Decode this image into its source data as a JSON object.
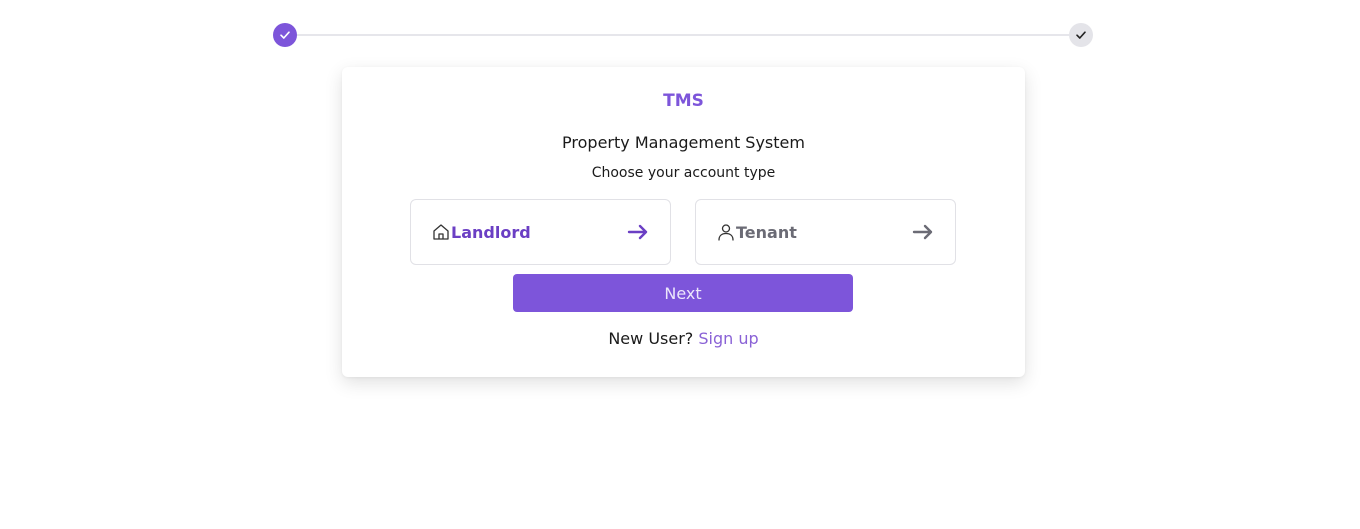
{
  "stepper": {
    "steps": [
      {
        "status": "complete",
        "icon": "check-icon",
        "color": "#7d55da"
      },
      {
        "status": "complete",
        "icon": "check-icon",
        "color": "#e4e4e9"
      }
    ]
  },
  "card": {
    "brand": "TMS",
    "subtitle": "Property Management System",
    "prompt": "Choose your account type",
    "options": [
      {
        "label": "Landlord",
        "icon": "home-icon",
        "selected": true
      },
      {
        "label": "Tenant",
        "icon": "user-icon",
        "selected": false
      }
    ],
    "next_label": "Next",
    "signup_text": "New User?",
    "signup_link": "Sign up"
  },
  "colors": {
    "accent": "#7d55da",
    "selected_text": "#6b3fc4",
    "muted_text": "#6b6b75"
  }
}
